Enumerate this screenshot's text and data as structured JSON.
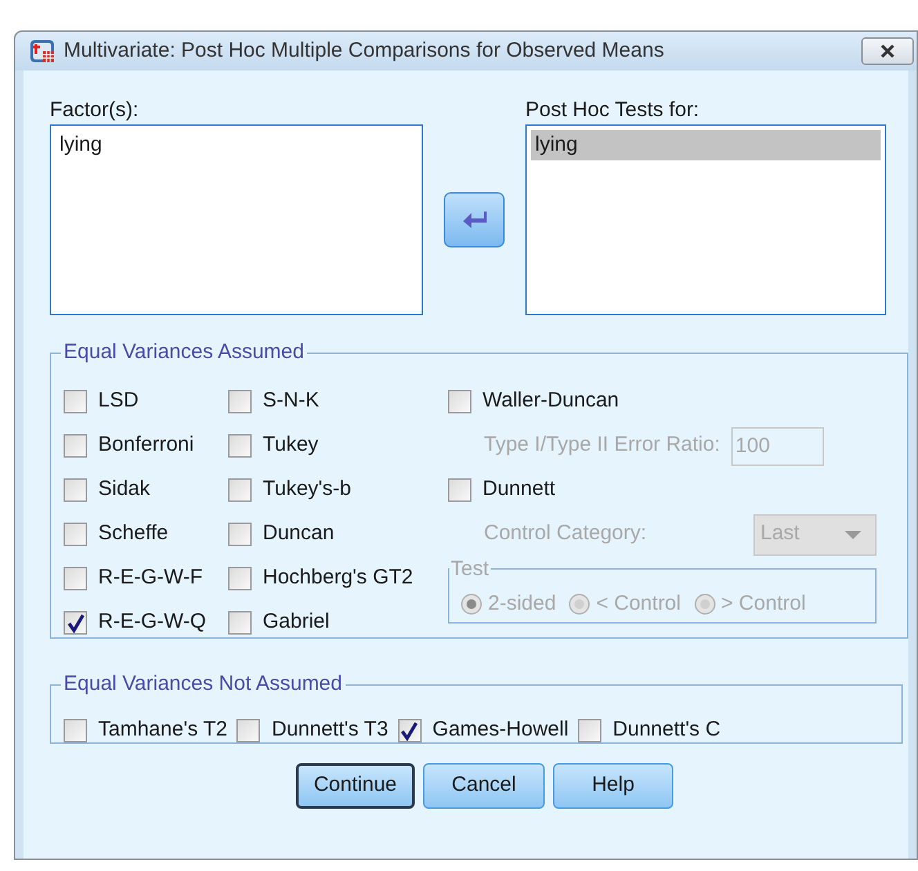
{
  "window": {
    "title": "Multivariate: Post Hoc Multiple Comparisons for Observed Means"
  },
  "factors": {
    "label": "Factor(s):",
    "items": [
      {
        "label": "lying",
        "selected": false
      }
    ]
  },
  "post_hoc_for": {
    "label": "Post Hoc Tests for:",
    "items": [
      {
        "label": "lying",
        "selected": true
      }
    ]
  },
  "equal_variances_assumed": {
    "title": "Equal Variances Assumed",
    "columns": [
      [
        {
          "label": "LSD",
          "checked": false
        },
        {
          "label": "Bonferroni",
          "checked": false
        },
        {
          "label": "Sidak",
          "checked": false
        },
        {
          "label": "Scheffe",
          "checked": false
        },
        {
          "label": "R-E-G-W-F",
          "checked": false
        },
        {
          "label": "R-E-G-W-Q",
          "checked": true
        }
      ],
      [
        {
          "label": "S-N-K",
          "checked": false
        },
        {
          "label": "Tukey",
          "checked": false
        },
        {
          "label": "Tukey's-b",
          "checked": false
        },
        {
          "label": "Duncan",
          "checked": false
        },
        {
          "label": "Hochberg's GT2",
          "checked": false
        },
        {
          "label": "Gabriel",
          "checked": false
        }
      ]
    ],
    "waller_duncan": {
      "label": "Waller-Duncan",
      "checked": false
    },
    "error_ratio": {
      "label": "Type I/Type II Error Ratio:",
      "value": "100",
      "disabled": true
    },
    "dunnett": {
      "label": "Dunnett",
      "checked": false
    },
    "control_category": {
      "label": "Control Category:",
      "value": "Last",
      "disabled": true
    },
    "test": {
      "title": "Test",
      "disabled": true,
      "options": [
        {
          "label": "2-sided",
          "selected": true
        },
        {
          "label": "< Control",
          "selected": false
        },
        {
          "label": "> Control",
          "selected": false
        }
      ]
    }
  },
  "equal_variances_not_assumed": {
    "title": "Equal Variances Not Assumed",
    "tests": [
      {
        "label": "Tamhane's T2",
        "checked": false
      },
      {
        "label": "Dunnett's T3",
        "checked": false
      },
      {
        "label": "Games-Howell",
        "checked": true
      },
      {
        "label": "Dunnett's C",
        "checked": false
      }
    ]
  },
  "buttons": [
    {
      "label": "Continue",
      "default": true
    },
    {
      "label": "Cancel",
      "default": false
    },
    {
      "label": "Help",
      "default": false
    }
  ]
}
